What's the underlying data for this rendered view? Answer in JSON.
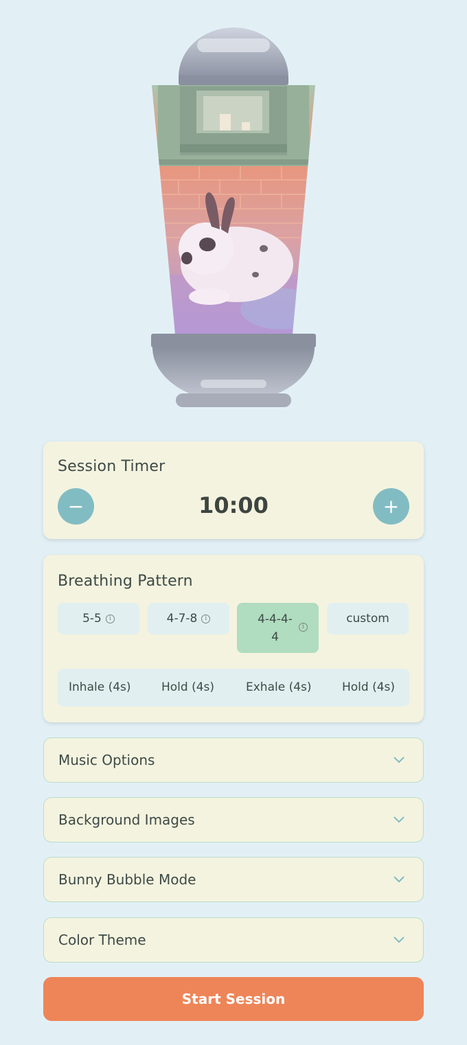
{
  "timer": {
    "title": "Session Timer",
    "value": "10:00",
    "minus_symbol": "−",
    "plus_symbol": "+"
  },
  "breathing": {
    "title": "Breathing Pattern",
    "patterns": [
      {
        "label": "5-5",
        "has_info": true,
        "active": false
      },
      {
        "label": "4-7-8",
        "has_info": true,
        "active": false
      },
      {
        "label": "4-4-4-4",
        "label_line1": "4-4-4-",
        "label_line2": "4",
        "has_info": true,
        "active": true
      },
      {
        "label": "custom",
        "has_info": false,
        "active": false
      }
    ],
    "info_glyph": "i",
    "phases": [
      "Inhale (4s)",
      "Hold (4s)",
      "Exhale (4s)",
      "Hold (4s)"
    ]
  },
  "accordions": [
    {
      "label": "Music Options",
      "icon": "chevron-down-icon"
    },
    {
      "label": "Background Images",
      "icon": "chevron-down-icon"
    },
    {
      "label": "Bunny Bubble Mode",
      "icon": "chevron-down-icon"
    },
    {
      "label": "Color Theme",
      "icon": "chevron-down-icon"
    }
  ],
  "start_button": {
    "label": "Start Session"
  },
  "colors": {
    "page_bg": "#e2f0f6",
    "card_bg": "#f4f3df",
    "accent_teal": "#82bcc3",
    "active_green": "#b0dcc0",
    "start_orange": "#ee8558"
  }
}
